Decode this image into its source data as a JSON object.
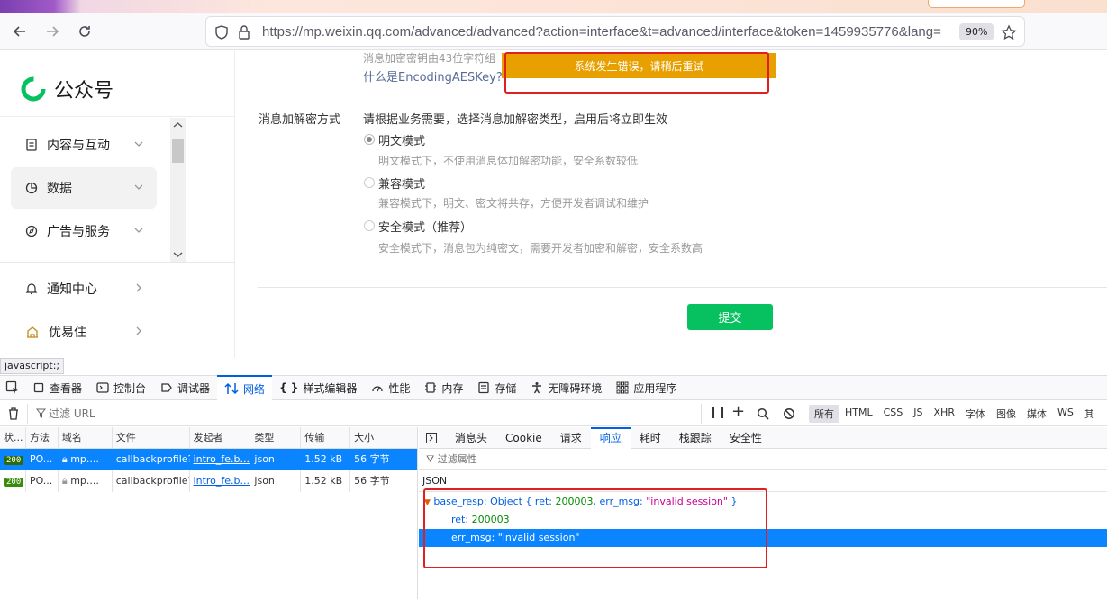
{
  "browser": {
    "url": "https://mp.weixin.qq.com/advanced/advanced?action=interface&t=advanced/interface&token=1459935776&lang=",
    "zoom": "90%"
  },
  "sidebar": {
    "logo_text": "公众号",
    "items": [
      {
        "label": "内容与互动"
      },
      {
        "label": "数据"
      },
      {
        "label": "广告与服务"
      },
      {
        "label": "通知中心"
      },
      {
        "label": "优易住"
      }
    ]
  },
  "main": {
    "key_desc_partial": "消息加密密钥由43位字符组",
    "aes_link": "什么是EncodingAESKey?",
    "toast": "系统发生错误，请稍后重试",
    "mode_label": "消息加解密方式",
    "mode_desc": "请根据业务需要，选择消息加解密类型，启用后将立即生效",
    "options": [
      {
        "title": "明文模式",
        "desc": "明文模式下，不使用消息体加解密功能，安全系数较低",
        "checked": true
      },
      {
        "title": "兼容模式",
        "desc": "兼容模式下，明文、密文将共存，方便开发者调试和维护",
        "checked": false
      },
      {
        "title": "安全模式（推荐）",
        "desc": "安全模式下，消息包为纯密文，需要开发者加密和解密，安全系数高",
        "checked": false
      }
    ],
    "submit": "提交"
  },
  "status_link": "javascript:;",
  "devtools": {
    "tabs": [
      "查看器",
      "控制台",
      "调试器",
      "网络",
      "样式编辑器",
      "性能",
      "内存",
      "存储",
      "无障碍环境",
      "应用程序"
    ],
    "active_tab": "网络",
    "filter_placeholder": "过滤 URL",
    "types": [
      "所有",
      "HTML",
      "CSS",
      "JS",
      "XHR",
      "字体",
      "图像",
      "媒体",
      "WS",
      "其"
    ],
    "columns": [
      "状...",
      "方法",
      "域名",
      "文件",
      "发起者",
      "类型",
      "传输",
      "大小"
    ],
    "rows": [
      {
        "status": "200",
        "method": "PO...",
        "domain": "mp....",
        "file": "callbackprofile?",
        "initiator": "intro_fe.b...",
        "type": "json",
        "transfer": "1.52 kB",
        "size": "56 字节"
      },
      {
        "status": "200",
        "method": "PO...",
        "domain": "mp....",
        "file": "callbackprofile?",
        "initiator": "intro_fe.b...",
        "type": "json",
        "transfer": "1.52 kB",
        "size": "56 字节"
      }
    ],
    "resp_tabs": [
      "消息头",
      "Cookie",
      "请求",
      "响应",
      "耗时",
      "栈跟踪",
      "安全性"
    ],
    "resp_active": "响应",
    "resp_filter": "过滤属性",
    "json_label": "JSON",
    "json": {
      "root_key": "base_resp",
      "root_summary_prefix": "Object { ret: ",
      "root_ret": "200003",
      "root_mid": ", err_msg: ",
      "root_err": "\"invalid session\"",
      "root_suffix": " }",
      "ret_key": "ret",
      "ret_val": "200003",
      "err_key": "err_msg",
      "err_val": "\"invalid session\""
    }
  }
}
